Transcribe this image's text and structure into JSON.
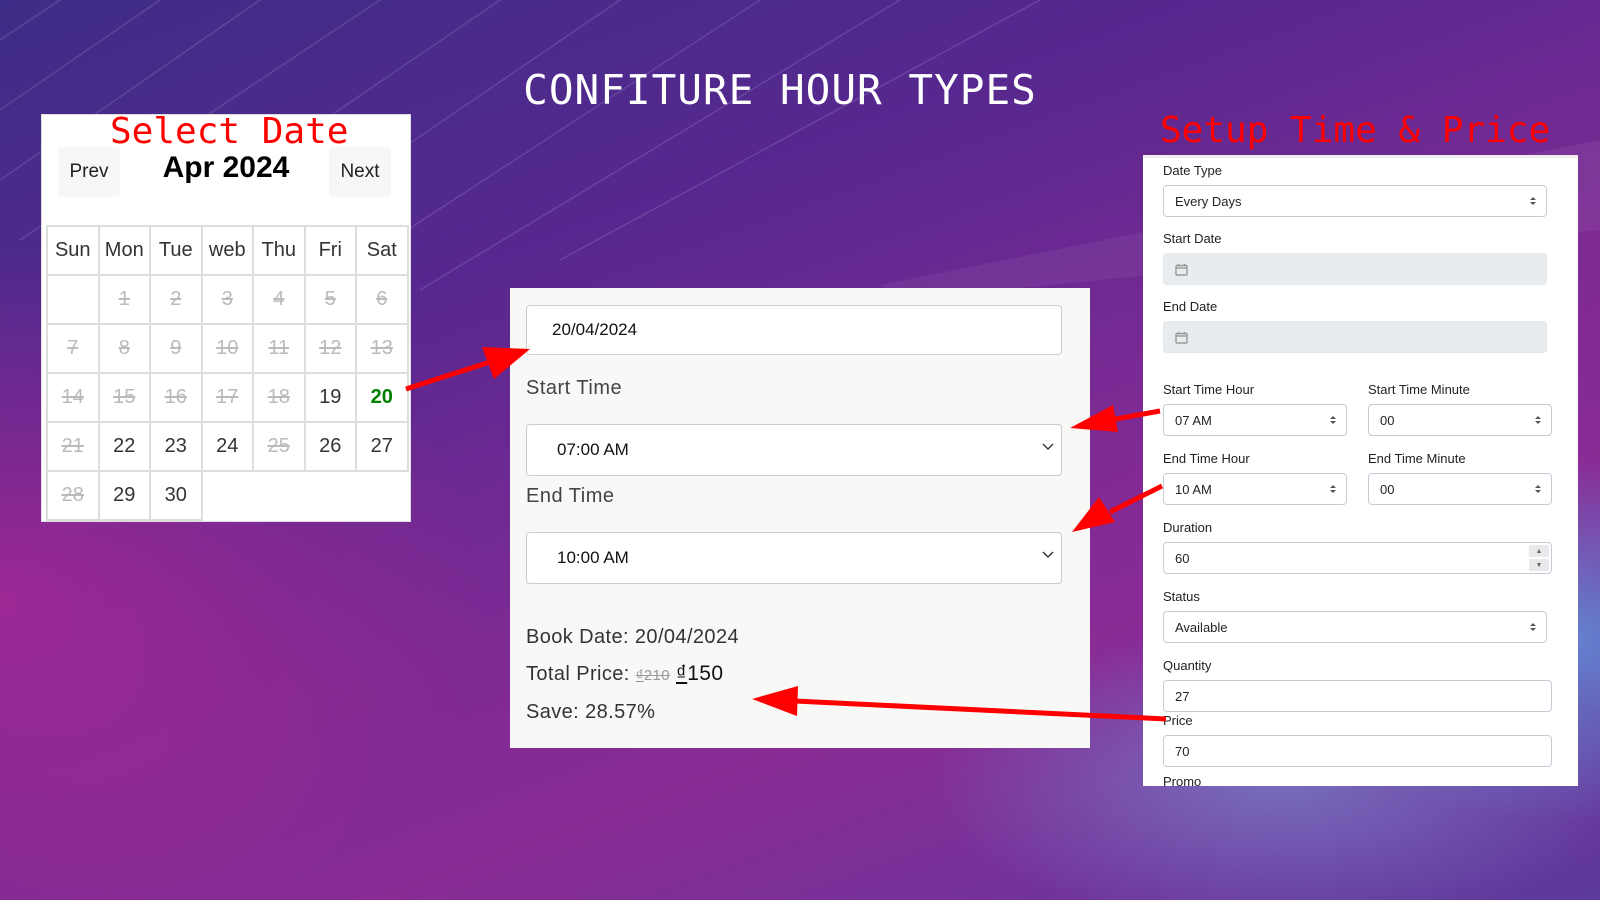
{
  "page": {
    "title": "CONFITURE HOUR TYPES"
  },
  "calendar_panel": {
    "heading": "Select Date",
    "prev_label": "Prev",
    "next_label": "Next",
    "month_label": "Apr 2024",
    "weekdays": [
      "Sun",
      "Mon",
      "Tue",
      "web",
      "Thu",
      "Fri",
      "Sat"
    ],
    "weeks": [
      [
        {
          "d": "",
          "s": "blank"
        },
        {
          "d": "1",
          "s": "disabled"
        },
        {
          "d": "2",
          "s": "disabled"
        },
        {
          "d": "3",
          "s": "disabled"
        },
        {
          "d": "4",
          "s": "disabled"
        },
        {
          "d": "5",
          "s": "disabled"
        },
        {
          "d": "6",
          "s": "disabled"
        }
      ],
      [
        {
          "d": "7",
          "s": "disabled"
        },
        {
          "d": "8",
          "s": "disabled"
        },
        {
          "d": "9",
          "s": "disabled"
        },
        {
          "d": "10",
          "s": "disabled"
        },
        {
          "d": "11",
          "s": "disabled"
        },
        {
          "d": "12",
          "s": "disabled"
        },
        {
          "d": "13",
          "s": "disabled"
        }
      ],
      [
        {
          "d": "14",
          "s": "disabled"
        },
        {
          "d": "15",
          "s": "disabled"
        },
        {
          "d": "16",
          "s": "disabled"
        },
        {
          "d": "17",
          "s": "disabled"
        },
        {
          "d": "18",
          "s": "disabled"
        },
        {
          "d": "19",
          "s": "available"
        },
        {
          "d": "20",
          "s": "selected"
        }
      ],
      [
        {
          "d": "21",
          "s": "disabled"
        },
        {
          "d": "22",
          "s": "available"
        },
        {
          "d": "23",
          "s": "available"
        },
        {
          "d": "24",
          "s": "available"
        },
        {
          "d": "25",
          "s": "disabled"
        },
        {
          "d": "26",
          "s": "available"
        },
        {
          "d": "27",
          "s": "available"
        }
      ],
      [
        {
          "d": "28",
          "s": "disabled"
        },
        {
          "d": "29",
          "s": "available"
        },
        {
          "d": "30",
          "s": "available"
        },
        {
          "d": "",
          "s": "empty"
        },
        {
          "d": "",
          "s": "empty"
        },
        {
          "d": "",
          "s": "empty"
        },
        {
          "d": "",
          "s": "empty"
        }
      ]
    ],
    "selected_color": "#008000"
  },
  "booking_panel": {
    "date_value": "20/04/2024",
    "start_time_label": "Start Time",
    "start_time_value": "07:00 AM",
    "end_time_label": "End Time",
    "end_time_value": "10:00 AM",
    "book_date_text": "Book Date: 20/04/2024",
    "total_price_label": "Total Price:",
    "currency_symbol": "₫",
    "old_price": "210",
    "new_price": "150",
    "save_text": "Save: 28.57%"
  },
  "setup_panel": {
    "heading": "Setup Time & Price",
    "date_type_label": "Date Type",
    "date_type_value": "Every Days",
    "start_date_label": "Start Date",
    "start_date_value": "",
    "end_date_label": "End Date",
    "end_date_value": "",
    "start_time_hour_label": "Start Time Hour",
    "start_time_hour_value": "07 AM",
    "start_time_minute_label": "Start Time Minute",
    "start_time_minute_value": "00",
    "end_time_hour_label": "End Time Hour",
    "end_time_hour_value": "10 AM",
    "end_time_minute_label": "End Time Minute",
    "end_time_minute_value": "00",
    "duration_label": "Duration",
    "duration_value": "60",
    "status_label": "Status",
    "status_value": "Available",
    "quantity_label": "Quantity",
    "quantity_value": "27",
    "price_label": "Price",
    "price_value": "70",
    "promo_label": "Promo"
  },
  "colors": {
    "accent_red": "#ff0000",
    "selected_green": "#008000"
  }
}
